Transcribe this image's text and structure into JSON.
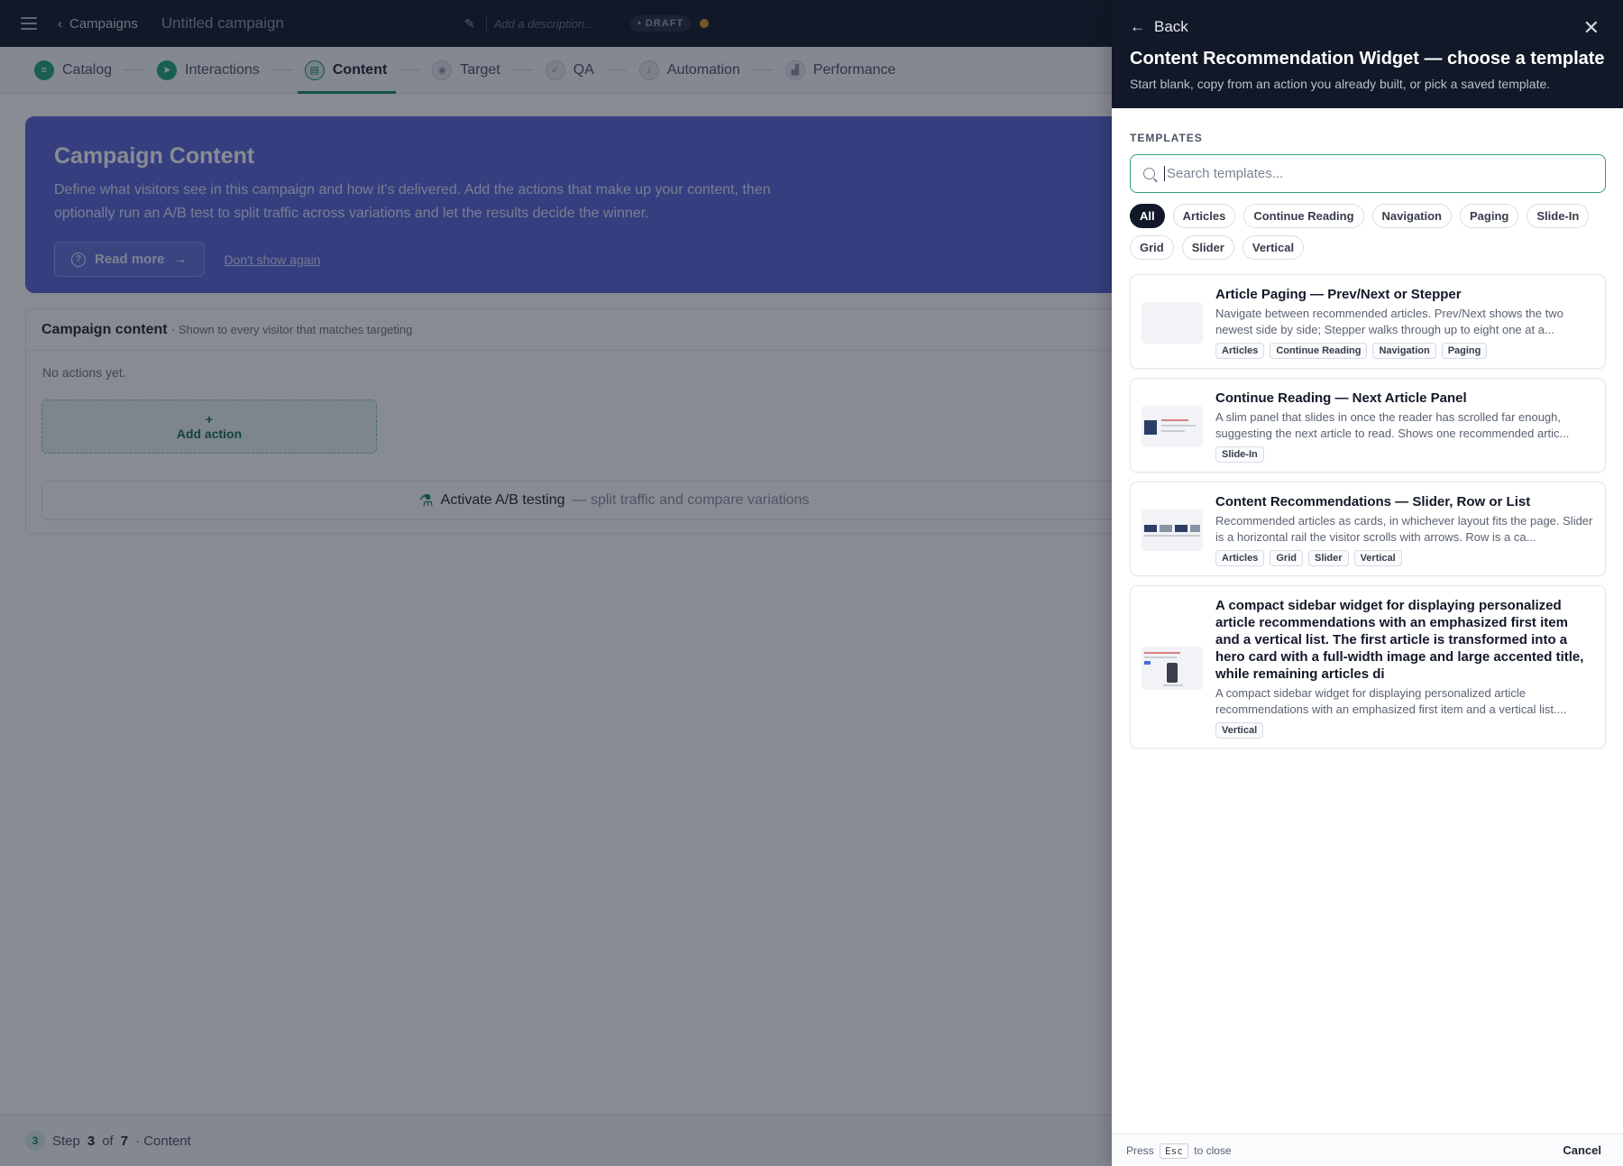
{
  "topbar": {
    "back_label": "Campaigns",
    "campaign_title": "Untitled campaign",
    "description_placeholder": "Add a description...",
    "status_badge": "DRAFT"
  },
  "steps": [
    {
      "label": "Catalog",
      "state": "done"
    },
    {
      "label": "Interactions",
      "state": "done"
    },
    {
      "label": "Content",
      "state": "current"
    },
    {
      "label": "Target",
      "state": "todo"
    },
    {
      "label": "QA",
      "state": "todo"
    },
    {
      "label": "Automation",
      "state": "todo"
    },
    {
      "label": "Performance",
      "state": "todo"
    }
  ],
  "banner": {
    "title": "Campaign Content",
    "text": "Define what visitors see in this campaign and how it's delivered. Add the actions that make up your content, then optionally run an A/B test to split traffic across variations and let the results decide the winner.",
    "read_more": "Read more",
    "dont_show": "Don't show again"
  },
  "content_box": {
    "title": "Campaign content",
    "subtitle": "· Shown to every visitor that matches targeting",
    "empty_text": "No actions yet.",
    "add_action_plus": "+",
    "add_action_label": "Add action",
    "ab_label": "Activate A/B testing",
    "ab_muted": "— split traffic and compare variations"
  },
  "footer": {
    "step_number": "3",
    "step_prefix": "Step",
    "step_current": "3",
    "step_of": "of",
    "step_total": "7",
    "step_suffix": "· Content"
  },
  "drawer": {
    "back_label": "Back",
    "title": "Content Recommendation Widget — choose a template",
    "subtitle": "Start blank, copy from an action you already built, or pick a saved template.",
    "section_label": "TEMPLATES",
    "search_placeholder": "Search templates...",
    "filters": [
      "All",
      "Articles",
      "Continue Reading",
      "Navigation",
      "Paging",
      "Slide-In",
      "Grid",
      "Slider",
      "Vertical"
    ],
    "active_filter": "All",
    "templates": [
      {
        "title": "Article Paging — Prev/Next or Stepper",
        "description": "Navigate between recommended articles. Prev/Next shows the two newest side by side; Stepper walks through up to eight one at a...",
        "tags": [
          "Articles",
          "Continue Reading",
          "Navigation",
          "Paging"
        ]
      },
      {
        "title": "Continue Reading — Next Article Panel",
        "description": "A slim panel that slides in once the reader has scrolled far enough, suggesting the next article to read. Shows one recommended artic...",
        "tags": [
          "Slide-In"
        ]
      },
      {
        "title": "Content Recommendations — Slider, Row or List",
        "description": "Recommended articles as cards, in whichever layout fits the page. Slider is a horizontal rail the visitor scrolls with arrows. Row is a ca...",
        "tags": [
          "Articles",
          "Grid",
          "Slider",
          "Vertical"
        ]
      },
      {
        "title": "A compact sidebar widget for displaying personalized article recommendations with an emphasized first item and a vertical list. The first article is transformed into a hero card with a full-width image and large accented title, while remaining articles di",
        "description": "A compact sidebar widget for displaying personalized article recommendations with an emphasized first item and a vertical list....",
        "tags": [
          "Vertical"
        ]
      }
    ],
    "footer_press": "Press",
    "footer_key": "Esc",
    "footer_close": "to close",
    "cancel_label": "Cancel"
  }
}
